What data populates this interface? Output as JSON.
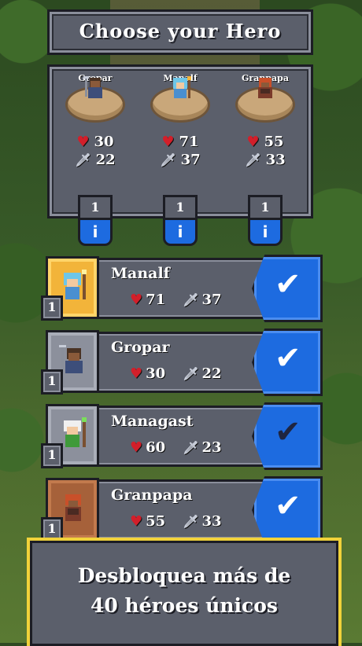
{
  "header": {
    "title": "Choose your Hero"
  },
  "party": [
    {
      "name": "Gropar",
      "hp": "30",
      "attack": "22",
      "level": "1",
      "info_icon": "i"
    },
    {
      "name": "Manalf",
      "hp": "71",
      "attack": "37",
      "level": "1",
      "info_icon": "i"
    },
    {
      "name": "Granpapa",
      "hp": "55",
      "attack": "33",
      "level": "1",
      "info_icon": "i"
    }
  ],
  "hero_list": [
    {
      "name": "Manalf",
      "hp": "71",
      "attack": "37",
      "level": "1",
      "check": "✔",
      "frame": "gold"
    },
    {
      "name": "Gropar",
      "hp": "30",
      "attack": "22",
      "level": "1",
      "check": "✔",
      "frame": "grey"
    },
    {
      "name": "Managast",
      "hp": "60",
      "attack": "23",
      "level": "1",
      "check": "✔",
      "frame": "grey"
    },
    {
      "name": "Granpapa",
      "hp": "55",
      "attack": "33",
      "level": "1",
      "check": "✔",
      "frame": "brown"
    }
  ],
  "icons": {
    "heart": "♥",
    "sword": "🗡"
  },
  "promo": {
    "line1": "Desbloquea más de",
    "line2": "40 héroes únicos"
  },
  "colors": {
    "accent_blue": "#1d6be0",
    "panel": "#5b5f6b",
    "gold": "#f1d23a"
  }
}
